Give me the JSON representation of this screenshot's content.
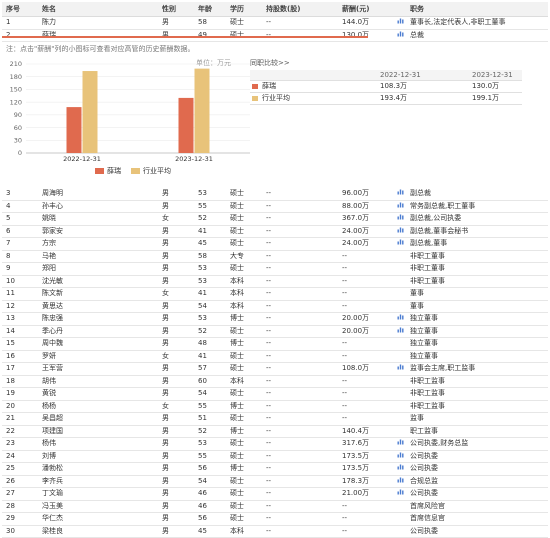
{
  "columns": [
    "序号",
    "姓名",
    "性别",
    "年龄",
    "学历",
    "持股数(股)",
    "薪酬(元)",
    "职务"
  ],
  "top_rows": [
    {
      "no": "1",
      "name": "陈力",
      "gender": "男",
      "age": "58",
      "edu": "硕士",
      "shares": "--",
      "pay": "144.0万",
      "title": "董事长,法定代表人,非职工董事",
      "has_chart": true
    },
    {
      "no": "2",
      "name": "薛瑞",
      "gender": "男",
      "age": "49",
      "edu": "硕士",
      "shares": "--",
      "pay": "130.0万",
      "title": "总裁",
      "has_chart": true
    }
  ],
  "note": "注：点击\"薪酬\"列的小图标可查看对应高管的历史薪酬数据。",
  "chart_data": {
    "type": "bar",
    "categories": [
      "2022-12-31",
      "2023-12-31"
    ],
    "series": [
      {
        "name": "薛瑞",
        "values": [
          108.3,
          130.0
        ],
        "color": "#e06a4e"
      },
      {
        "name": "行业平均",
        "values": [
          193.4,
          199.1
        ],
        "color": "#e8c37a"
      }
    ],
    "unit_label": "单位：万元",
    "ylim": [
      0,
      210
    ],
    "yticks": [
      "210",
      "180",
      "150",
      "120",
      "90",
      "60",
      "30",
      "0"
    ]
  },
  "comparison": {
    "title": "同职比较>>",
    "dates": [
      "2022-12-31",
      "2023-12-31"
    ],
    "rows": [
      {
        "label": "薛瑞",
        "color": "#e06a4e",
        "v1": "108.3万",
        "v2": "130.0万"
      },
      {
        "label": "行业平均",
        "color": "#e8c37a",
        "v1": "193.4万",
        "v2": "199.1万"
      }
    ]
  },
  "rows": [
    {
      "no": "3",
      "name": "周海明",
      "gender": "男",
      "age": "53",
      "edu": "硕士",
      "shares": "--",
      "pay": "96.00万",
      "title": "副总裁",
      "has_chart": true
    },
    {
      "no": "4",
      "name": "孙丰心",
      "gender": "男",
      "age": "55",
      "edu": "硕士",
      "shares": "--",
      "pay": "88.00万",
      "title": "常务副总裁,职工董事",
      "has_chart": true
    },
    {
      "no": "5",
      "name": "姚晓",
      "gender": "女",
      "age": "52",
      "edu": "硕士",
      "shares": "--",
      "pay": "367.0万",
      "title": "副总裁,公司执委",
      "has_chart": true
    },
    {
      "no": "6",
      "name": "郭家安",
      "gender": "男",
      "age": "41",
      "edu": "硕士",
      "shares": "--",
      "pay": "24.00万",
      "title": "副总裁,董事会秘书",
      "has_chart": true
    },
    {
      "no": "7",
      "name": "方宗",
      "gender": "男",
      "age": "45",
      "edu": "硕士",
      "shares": "--",
      "pay": "24.00万",
      "title": "副总裁,董事",
      "has_chart": true
    },
    {
      "no": "8",
      "name": "马艳",
      "gender": "男",
      "age": "58",
      "edu": "大专",
      "shares": "--",
      "pay": "--",
      "title": "非职工董事",
      "has_chart": false
    },
    {
      "no": "9",
      "name": "郑阳",
      "gender": "男",
      "age": "53",
      "edu": "硕士",
      "shares": "--",
      "pay": "--",
      "title": "非职工董事",
      "has_chart": false
    },
    {
      "no": "10",
      "name": "沈光敏",
      "gender": "男",
      "age": "53",
      "edu": "本科",
      "shares": "--",
      "pay": "--",
      "title": "非职工董事",
      "has_chart": false
    },
    {
      "no": "11",
      "name": "陈文新",
      "gender": "女",
      "age": "41",
      "edu": "本科",
      "shares": "--",
      "pay": "--",
      "title": "董事",
      "has_chart": false
    },
    {
      "no": "12",
      "name": "黄思达",
      "gender": "男",
      "age": "54",
      "edu": "本科",
      "shares": "--",
      "pay": "--",
      "title": "董事",
      "has_chart": false
    },
    {
      "no": "13",
      "name": "陈忠强",
      "gender": "男",
      "age": "53",
      "edu": "博士",
      "shares": "--",
      "pay": "20.00万",
      "title": "独立董事",
      "has_chart": true
    },
    {
      "no": "14",
      "name": "季心丹",
      "gender": "男",
      "age": "52",
      "edu": "硕士",
      "shares": "--",
      "pay": "20.00万",
      "title": "独立董事",
      "has_chart": true
    },
    {
      "no": "15",
      "name": "周中魏",
      "gender": "男",
      "age": "48",
      "edu": "博士",
      "shares": "--",
      "pay": "--",
      "title": "独立董事",
      "has_chart": false
    },
    {
      "no": "16",
      "name": "罗妍",
      "gender": "女",
      "age": "41",
      "edu": "硕士",
      "shares": "--",
      "pay": "--",
      "title": "独立董事",
      "has_chart": false
    },
    {
      "no": "17",
      "name": "王军营",
      "gender": "男",
      "age": "57",
      "edu": "硕士",
      "shares": "--",
      "pay": "108.0万",
      "title": "监事会主席,职工监事",
      "has_chart": true
    },
    {
      "no": "18",
      "name": "胡伟",
      "gender": "男",
      "age": "60",
      "edu": "本科",
      "shares": "--",
      "pay": "--",
      "title": "非职工监事",
      "has_chart": false
    },
    {
      "no": "19",
      "name": "黄锐",
      "gender": "男",
      "age": "54",
      "edu": "硕士",
      "shares": "--",
      "pay": "--",
      "title": "非职工监事",
      "has_chart": false
    },
    {
      "no": "20",
      "name": "杨杨",
      "gender": "女",
      "age": "55",
      "edu": "博士",
      "shares": "--",
      "pay": "--",
      "title": "非职工监事",
      "has_chart": false
    },
    {
      "no": "21",
      "name": "吴昌超",
      "gender": "男",
      "age": "51",
      "edu": "硕士",
      "shares": "--",
      "pay": "--",
      "title": "监事",
      "has_chart": false
    },
    {
      "no": "22",
      "name": "项建国",
      "gender": "男",
      "age": "52",
      "edu": "博士",
      "shares": "--",
      "pay": "140.4万",
      "title": "职工监事",
      "has_chart": false
    },
    {
      "no": "23",
      "name": "杨伟",
      "gender": "男",
      "age": "53",
      "edu": "硕士",
      "shares": "--",
      "pay": "317.6万",
      "title": "公司执委,财务总监",
      "has_chart": true
    },
    {
      "no": "24",
      "name": "刘博",
      "gender": "男",
      "age": "55",
      "edu": "硕士",
      "shares": "--",
      "pay": "173.5万",
      "title": "公司执委",
      "has_chart": true
    },
    {
      "no": "25",
      "name": "潘勃松",
      "gender": "男",
      "age": "56",
      "edu": "博士",
      "shares": "--",
      "pay": "173.5万",
      "title": "公司执委",
      "has_chart": true
    },
    {
      "no": "26",
      "name": "李齐兵",
      "gender": "男",
      "age": "54",
      "edu": "硕士",
      "shares": "--",
      "pay": "178.3万",
      "title": "合规总监",
      "has_chart": true
    },
    {
      "no": "27",
      "name": "丁文瑜",
      "gender": "男",
      "age": "46",
      "edu": "硕士",
      "shares": "--",
      "pay": "21.00万",
      "title": "公司执委",
      "has_chart": true
    },
    {
      "no": "28",
      "name": "冯玉美",
      "gender": "男",
      "age": "46",
      "edu": "硕士",
      "shares": "--",
      "pay": "--",
      "title": "首席风险官",
      "has_chart": false
    },
    {
      "no": "29",
      "name": "华仁杰",
      "gender": "男",
      "age": "56",
      "edu": "硕士",
      "shares": "--",
      "pay": "--",
      "title": "首席信息官",
      "has_chart": false
    },
    {
      "no": "30",
      "name": "梁桂良",
      "gender": "男",
      "age": "45",
      "edu": "本科",
      "shares": "--",
      "pay": "--",
      "title": "公司执委",
      "has_chart": false
    }
  ]
}
